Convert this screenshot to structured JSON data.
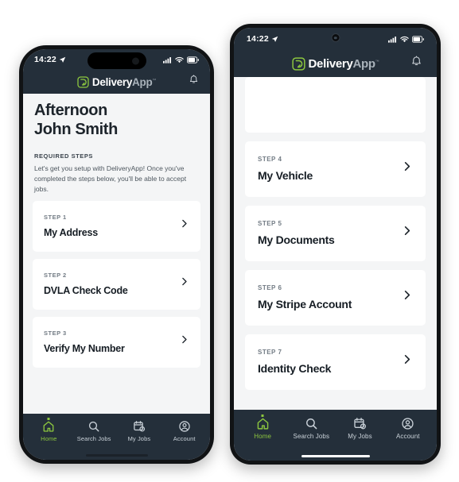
{
  "brand": {
    "name_bold": "Delivery",
    "name_light": "App",
    "trademark": "™",
    "accent_green": "#8cc63f",
    "dark_navy": "#242f3a",
    "card_white": "#ffffff",
    "page_grey": "#f4f5f6"
  },
  "status_bar": {
    "time": "14:22",
    "location_icon": "location-arrow-icon",
    "signal_icon": "cellular-signal-icon",
    "wifi_icon": "wifi-icon",
    "battery_icon": "battery-icon"
  },
  "app_bar": {
    "notification_icon": "bell-icon"
  },
  "left_phone": {
    "greeting_line1": "Afternoon",
    "greeting_line2": "John Smith",
    "section_heading": "REQUIRED STEPS",
    "section_body": "Let's get you setup with DeliveryApp! Once you've completed the steps below, you'll be able to accept jobs.",
    "cards": [
      {
        "step": "STEP 1",
        "title": "My Address",
        "chevron": "chevron-right-icon"
      },
      {
        "step": "STEP 2",
        "title": "DVLA Check Code",
        "chevron": "chevron-right-icon"
      },
      {
        "step": "STEP 3",
        "title": "Verify My Number",
        "chevron": "chevron-right-icon"
      }
    ]
  },
  "right_phone": {
    "cards": [
      {
        "step": "STEP 4",
        "title": "My Vehicle",
        "chevron": "chevron-right-icon"
      },
      {
        "step": "STEP 5",
        "title": "My Documents",
        "chevron": "chevron-right-icon"
      },
      {
        "step": "STEP 6",
        "title": "My Stripe Account",
        "chevron": "chevron-right-icon"
      },
      {
        "step": "STEP 7",
        "title": "Identity Check",
        "chevron": "chevron-right-icon"
      }
    ]
  },
  "bottom_nav": {
    "items": [
      {
        "label": "Home",
        "icon": "home-icon",
        "active": true
      },
      {
        "label": "Search Jobs",
        "icon": "search-icon",
        "active": false
      },
      {
        "label": "My Jobs",
        "icon": "calendar-clock-icon",
        "active": false
      },
      {
        "label": "Account",
        "icon": "account-circle-icon",
        "active": false
      }
    ]
  }
}
